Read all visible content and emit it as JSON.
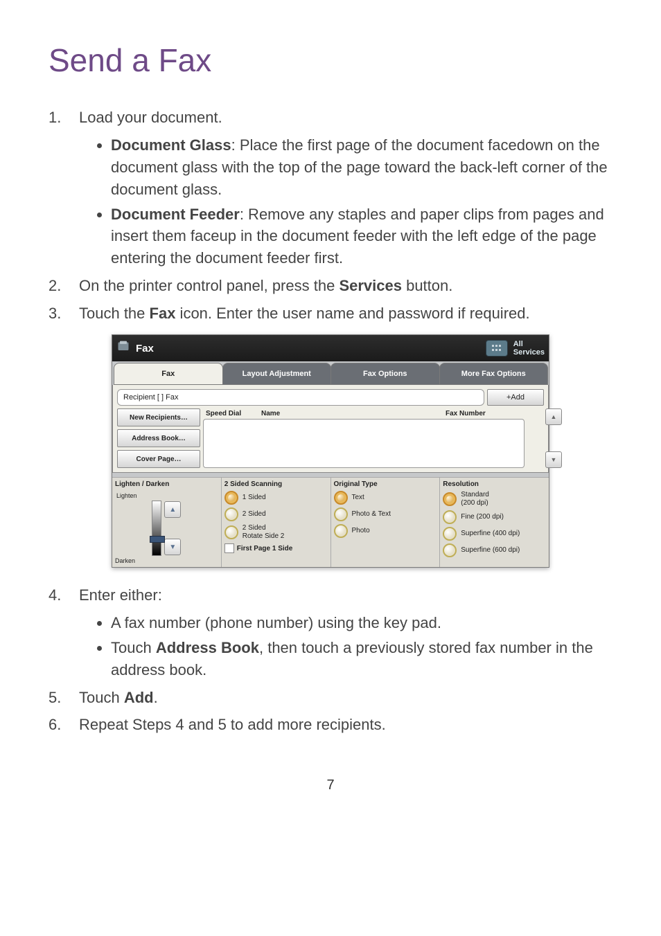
{
  "doc": {
    "title": "Send a Fax",
    "page_number": "7",
    "steps": {
      "s1": {
        "prefix": "Load your document."
      },
      "s1_glass_label": "Document Glass",
      "s1_glass_text": ": Place the first page of the document facedown on the document glass with the top of the page toward the back-left corner of the document glass.",
      "s1_feeder_label": "Document Feeder",
      "s1_feeder_text": ": Remove any staples and paper clips from pages and insert them faceup in the document feeder with the left edge of the page entering the document feeder first.",
      "s2_a": "On the printer control panel, press the ",
      "s2_b": "Services",
      "s2_c": " button.",
      "s3_a": "Touch the ",
      "s3_b": "Fax",
      "s3_c": " icon. Enter the user name and password if required.",
      "s4": "Enter either:",
      "s4_opt1": "A fax number (phone number) using the key pad.",
      "s4_opt2_a": "Touch ",
      "s4_opt2_b": "Address Book",
      "s4_opt2_c": ", then touch a previously stored fax number in the address book.",
      "s5_a": "Touch ",
      "s5_b": "Add",
      "s5_c": ".",
      "s6": "Repeat Steps 4 and 5 to add more recipients."
    }
  },
  "panel": {
    "top_title": "Fax",
    "all_services_l1": "All",
    "all_services_l2": "Services",
    "tabs": {
      "t1": "Fax",
      "t2": "Layout Adjustment",
      "t3": "Fax Options",
      "t4": "More Fax Options"
    },
    "recipient_field": "Recipient [   ] Fax",
    "add_btn": "+Add",
    "left_buttons": {
      "b1": "New Recipients…",
      "b2": "Address Book…",
      "b3": "Cover Page…"
    },
    "col_headers": {
      "c1": "Speed Dial",
      "c2": "Name",
      "c3": "Fax Number"
    },
    "opt_headers": {
      "h1": "Lighten / Darken",
      "h2": "2 Sided Scanning",
      "h3": "Original Type",
      "h4": "Resolution"
    },
    "lighten_label": "Lighten",
    "darken_label": "Darken",
    "sided": {
      "o1": "1 Sided",
      "o2": "2 Sided",
      "o3a": "2 Sided",
      "o3b": "Rotate Side 2",
      "cb": "First Page 1 Side"
    },
    "orig": {
      "o1": "Text",
      "o2": "Photo & Text",
      "o3": "Photo"
    },
    "res": {
      "o1a": "Standard",
      "o1b": "(200 dpi)",
      "o2": "Fine (200 dpi)",
      "o3": "Superfine (400 dpi)",
      "o4": "Superfine (600 dpi)"
    }
  }
}
